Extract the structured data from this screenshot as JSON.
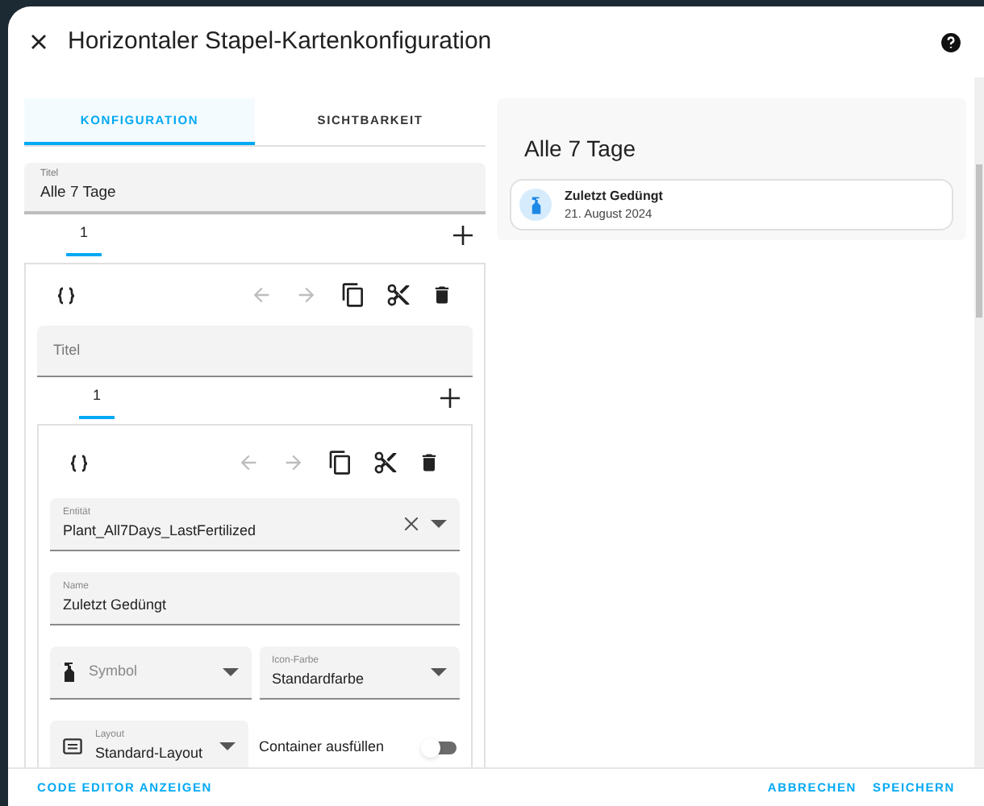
{
  "dialog": {
    "title": "Horizontaler Stapel-Kartenkonfiguration"
  },
  "tabs": [
    {
      "label": "KONFIGURATION",
      "selected": true
    },
    {
      "label": "SICHTBARKEIT",
      "selected": false
    }
  ],
  "title_field": {
    "label": "Titel",
    "value": "Alle 7 Tage"
  },
  "card_tabs": [
    {
      "label": "1",
      "selected": true
    }
  ],
  "card": {
    "move_disabled": true,
    "title_field": {
      "placeholder": "Titel"
    },
    "card_tabs": [
      {
        "label": "1",
        "selected": true
      }
    ],
    "entity_card": {
      "move_disabled": true,
      "entity": {
        "label": "Entität",
        "value": "Plant_All7Days_LastFertilized"
      },
      "name": {
        "label": "Name",
        "value": "Zuletzt Gedüngt"
      },
      "symbol": {
        "placeholder": "Symbol"
      },
      "icon_color": {
        "label": "Icon-Farbe",
        "value": "Standardfarbe"
      },
      "layout": {
        "label": "Layout",
        "value": "Standard-Layout"
      },
      "fill_container": {
        "label": "Container ausfüllen",
        "on": false
      }
    }
  },
  "preview": {
    "title": "Alle 7 Tage",
    "entity": {
      "name": "Zuletzt Gedüngt",
      "date": "21. August 2024"
    }
  },
  "footer": {
    "code_button": "CODE EDITOR ANZEIGEN",
    "buttons": [
      "ABBRECHEN",
      "SPEICHERN"
    ]
  }
}
